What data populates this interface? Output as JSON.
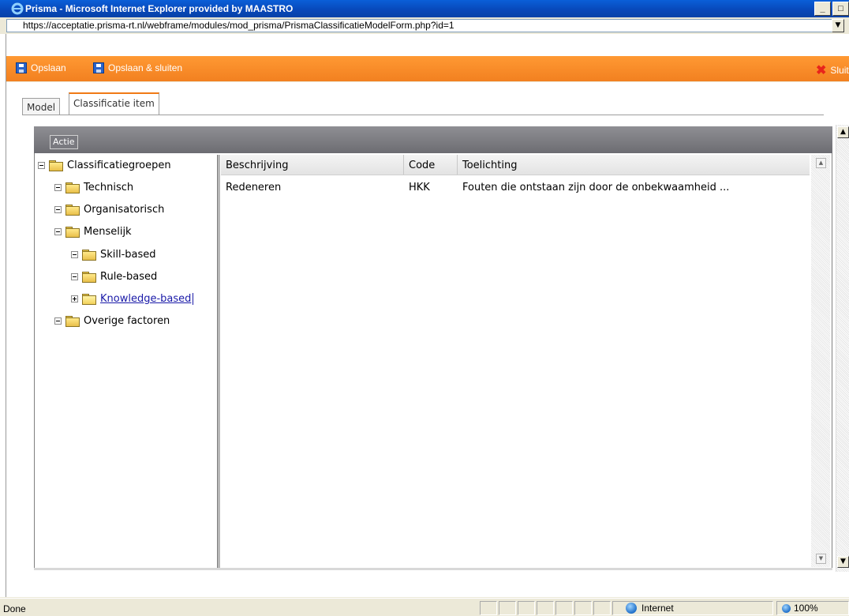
{
  "window": {
    "title": "Prisma - Microsoft Internet Explorer provided by MAASTRO"
  },
  "address": {
    "url": "https://acceptatie.prisma-rt.nl/webframe/modules/mod_prisma/PrismaClassificatieModelForm.php?id=1"
  },
  "toolbar": {
    "save_label": "Opslaan",
    "save_close_label": "Opslaan & sluiten",
    "close_label": "Sluit"
  },
  "tabs": [
    {
      "label": "Model"
    },
    {
      "label": "Classificatie item"
    }
  ],
  "panel": {
    "action_label": "Actie"
  },
  "tree": {
    "root": "Classificatiegroepen",
    "items": [
      {
        "label": "Technisch"
      },
      {
        "label": "Organisatorisch"
      },
      {
        "label": "Menselijk"
      },
      {
        "label": "Skill-based"
      },
      {
        "label": "Rule-based"
      },
      {
        "label": "Knowledge-based"
      },
      {
        "label": "Overige factoren"
      }
    ]
  },
  "grid": {
    "columns": [
      "Beschrijving",
      "Code",
      "Toelichting"
    ],
    "rows": [
      {
        "beschrijving": "Redeneren",
        "code": "HKK",
        "toelichting": "Fouten die ontstaan zijn door de onbekwaamheid ..."
      }
    ]
  },
  "status": {
    "text": "Done",
    "zone": "Internet",
    "zoom": "100%"
  },
  "colors": {
    "toolbar_accent": "#f07a16",
    "tab_accent": "#f07a16",
    "panel_header": "#7a7a80"
  }
}
